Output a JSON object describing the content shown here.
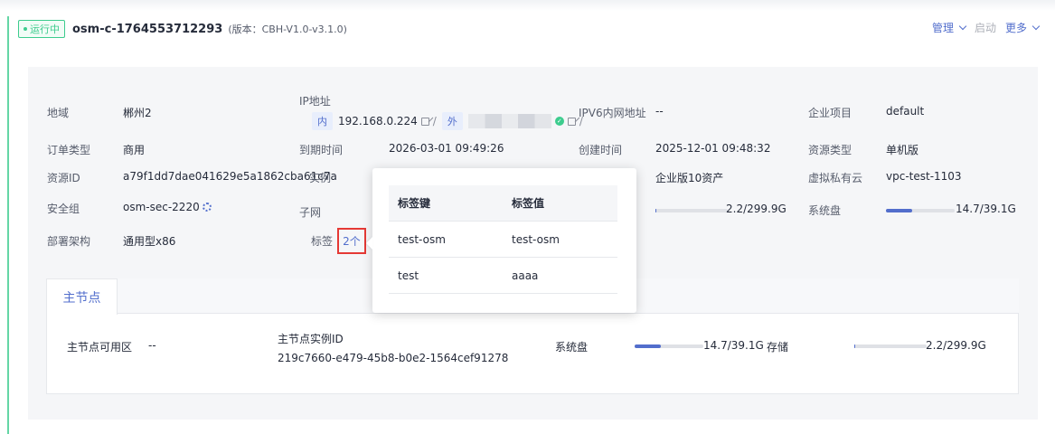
{
  "header": {
    "status": "运行中",
    "instance_name": "osm-c-1764553712293",
    "version": "(版本：CBH-V1.0-v3.1.0)",
    "actions": {
      "manage": "管理",
      "start": "启动",
      "more": "更多"
    }
  },
  "details": {
    "region_label": "地域",
    "region_value": "郴州2",
    "ip_label": "IP地址",
    "ip_inner_tag": "内",
    "ip_inner_value": "192.168.0.224",
    "ip_outer_tag": "外",
    "ipv6_label": "IPV6内网地址",
    "ipv6_value": "--",
    "enterprise_label": "企业项目",
    "enterprise_value": "default",
    "order_type_label": "订单类型",
    "order_type_value": "商用",
    "expire_label": "到期时间",
    "expire_value": "2026-03-01 09:49:26",
    "created_label": "创建时间",
    "created_value": "2025-12-01 09:48:32",
    "resource_type_label": "资源类型",
    "resource_type_value": "单机版",
    "resource_id_label": "资源ID",
    "resource_id_value": "a79f1dd7dae041629e5a1862cba61c7a",
    "instance_label": "实例",
    "spec_value": "企业版10资产",
    "vpc_label": "虚拟私有云",
    "vpc_value": "vpc-test-1103",
    "sg_label": "安全组",
    "sg_value": "osm-sec-2220",
    "subnet_label": "子网",
    "storage_usage_value": "2.2/299.9G",
    "sysdisk_label": "系统盘",
    "sysdisk_value": "14.7/39.1G",
    "arch_label": "部署架构",
    "arch_value": "通用型x86",
    "tags_label": "标签",
    "tags_count": "2个"
  },
  "usage": {
    "storage_fraction": 0.007,
    "sysdisk_fraction": 0.376
  },
  "tags_popover": {
    "col_key": "标签键",
    "col_value": "标签值",
    "rows": [
      {
        "key": "test-osm",
        "value": "test-osm"
      },
      {
        "key": "test",
        "value": "aaaa"
      }
    ]
  },
  "master_tab": {
    "tab_label": "主节点",
    "az_label": "主节点可用区",
    "az_value": "--",
    "instance_id_label": "主节点实例ID",
    "instance_id_value": "219c7660-e479-45b8-b0e2-1564cef91278",
    "sysdisk_label": "系统盘",
    "sysdisk_value": "14.7/39.1G",
    "storage_label": "存储",
    "storage_value": "2.2/299.9G"
  },
  "colors": {
    "accent": "#526ecc",
    "status_green": "#3dcc8e",
    "highlight_red": "#e53935"
  }
}
